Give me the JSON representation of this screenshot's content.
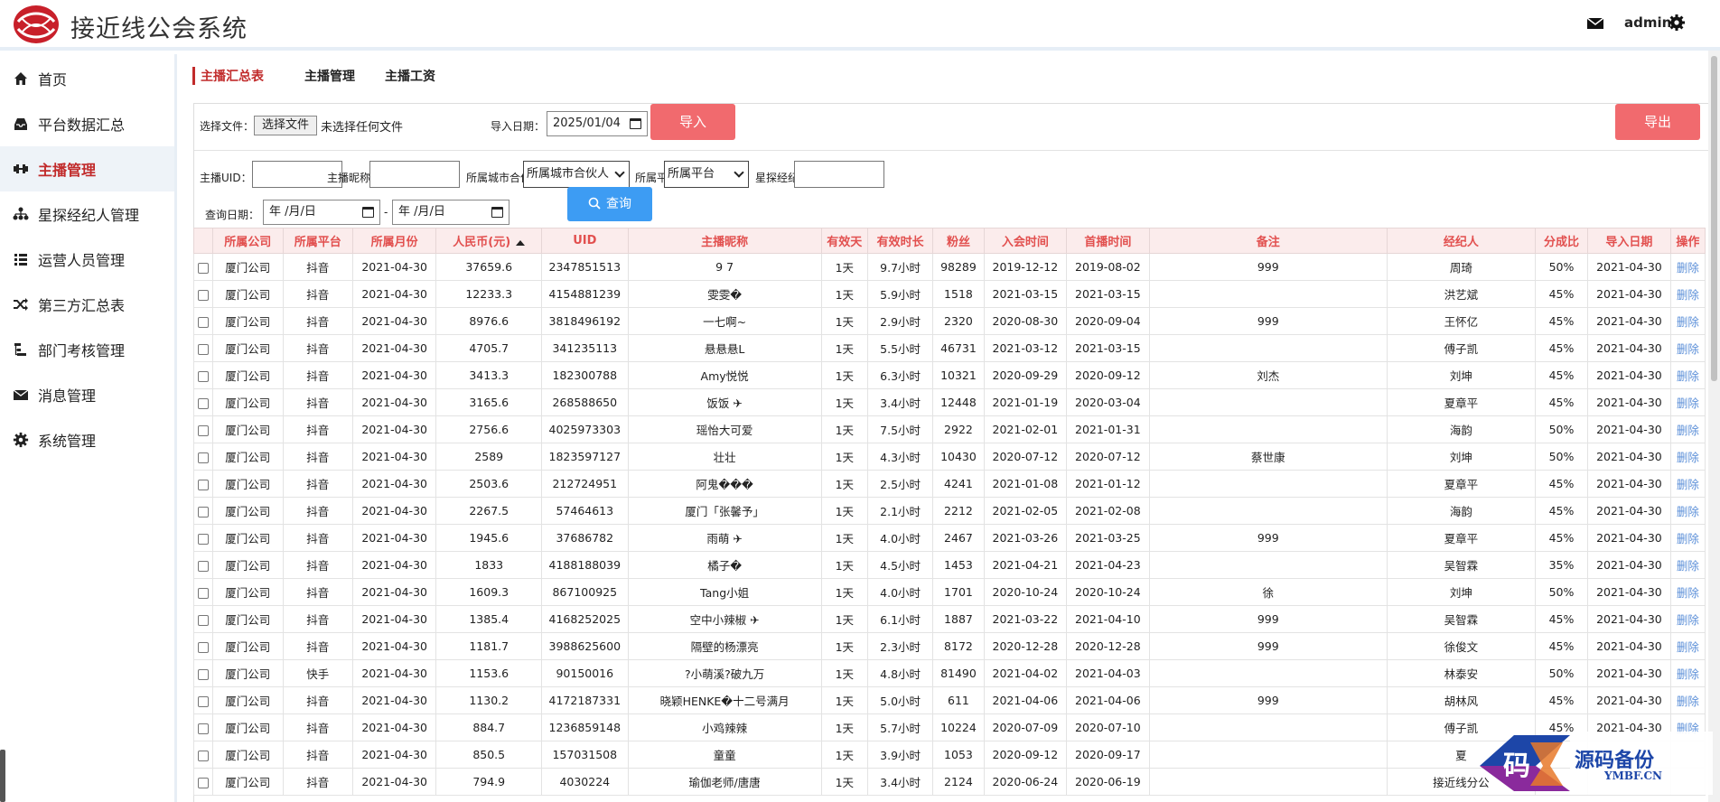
{
  "header": {
    "app_title": "接近线公会系统",
    "user": "admin"
  },
  "sidebar": {
    "items": [
      {
        "label": "首页",
        "icon": "home-icon"
      },
      {
        "label": "平台数据汇总",
        "icon": "inbox-icon"
      },
      {
        "label": "主播管理",
        "icon": "dumbbell-icon"
      },
      {
        "label": "星探经纪人管理",
        "icon": "sitemap-icon"
      },
      {
        "label": "运营人员管理",
        "icon": "list-icon"
      },
      {
        "label": "第三方汇总表",
        "icon": "shuffle-icon"
      },
      {
        "label": "部门考核管理",
        "icon": "tree-icon"
      },
      {
        "label": "消息管理",
        "icon": "envelope-icon"
      },
      {
        "label": "系统管理",
        "icon": "gear-icon"
      }
    ],
    "active_index": 2
  },
  "tabs": {
    "summary": "主播汇总表",
    "management": "主播管理",
    "salary": "主播工资"
  },
  "import_row": {
    "file_label": "选择文件：",
    "file_button": "选择文件",
    "file_status": "未选择任何文件",
    "date_label": "导入日期：",
    "date_value": "2025/01/04",
    "import_button": "导入",
    "export_button": "导出"
  },
  "search_row": {
    "uid_label": "主播UID：",
    "nick_label": "主播昵称：",
    "partner_label": "所属城市合伙人：",
    "partner_value": "所属城市合伙人",
    "platform_label": "所属平台：",
    "platform_value": "所属平台",
    "scout_label": "星探经纪人：",
    "query_date_label": "查询日期：",
    "date_placeholder": "年 /月/日",
    "search_button": "查询"
  },
  "table": {
    "headers": [
      "所属公司",
      "所属平台",
      "所属月份",
      "人民币(元)",
      "UID",
      "主播昵称",
      "有效天",
      "有效时长",
      "粉丝",
      "入会时间",
      "首播时间",
      "备注",
      "经纪人",
      "分成比",
      "导入日期",
      "操作"
    ],
    "rows": [
      [
        "厦门公司",
        "抖音",
        "2021-04-30",
        "37659.6",
        "2347851513",
        "9 7",
        "1天",
        "9.7小时",
        "98289",
        "2019-12-12",
        "2019-08-02",
        "999",
        "周琦",
        "50%",
        "2021-04-30",
        "删除"
      ],
      [
        "厦门公司",
        "抖音",
        "2021-04-30",
        "12233.3",
        "4154881239",
        "雯雯�",
        "1天",
        "5.9小时",
        "1518",
        "2021-03-15",
        "2021-03-15",
        "",
        "洪艺斌",
        "45%",
        "2021-04-30",
        "删除"
      ],
      [
        "厦门公司",
        "抖音",
        "2021-04-30",
        "8976.6",
        "3818496192",
        "一七啊~",
        "1天",
        "2.9小时",
        "2320",
        "2020-08-30",
        "2020-09-04",
        "999",
        "王怀亿",
        "45%",
        "2021-04-30",
        "删除"
      ],
      [
        "厦门公司",
        "抖音",
        "2021-04-30",
        "4705.7",
        "341235113",
        "悬悬悬L",
        "1天",
        "5.5小时",
        "46731",
        "2021-03-12",
        "2021-03-15",
        "",
        "傅子凯",
        "45%",
        "2021-04-30",
        "删除"
      ],
      [
        "厦门公司",
        "抖音",
        "2021-04-30",
        "3413.3",
        "182300788",
        "Amy悦悦",
        "1天",
        "6.3小时",
        "10321",
        "2020-09-29",
        "2020-09-12",
        "刘杰",
        "刘坤",
        "45%",
        "2021-04-30",
        "删除"
      ],
      [
        "厦门公司",
        "抖音",
        "2021-04-30",
        "3165.6",
        "268588650",
        "饭饭 ✈",
        "1天",
        "3.4小时",
        "12448",
        "2021-01-19",
        "2020-03-04",
        "",
        "夏章平",
        "45%",
        "2021-04-30",
        "删除"
      ],
      [
        "厦门公司",
        "抖音",
        "2021-04-30",
        "2756.6",
        "4025973303",
        "瑶怡大可爱",
        "1天",
        "7.5小时",
        "2922",
        "2021-02-01",
        "2021-01-31",
        "",
        "海韵",
        "50%",
        "2021-04-30",
        "删除"
      ],
      [
        "厦门公司",
        "抖音",
        "2021-04-30",
        "2589",
        "1823597127",
        "壮壮",
        "1天",
        "4.3小时",
        "10430",
        "2020-07-12",
        "2020-07-12",
        "蔡世康",
        "刘坤",
        "50%",
        "2021-04-30",
        "删除"
      ],
      [
        "厦门公司",
        "抖音",
        "2021-04-30",
        "2503.6",
        "212724951",
        "阿鬼���",
        "1天",
        "2.5小时",
        "4241",
        "2021-01-08",
        "2021-01-12",
        "",
        "夏章平",
        "45%",
        "2021-04-30",
        "删除"
      ],
      [
        "厦门公司",
        "抖音",
        "2021-04-30",
        "2267.5",
        "57464613",
        "厦门「张馨予」",
        "1天",
        "2.1小时",
        "2212",
        "2021-02-05",
        "2021-02-08",
        "",
        "海韵",
        "45%",
        "2021-04-30",
        "删除"
      ],
      [
        "厦门公司",
        "抖音",
        "2021-04-30",
        "1945.6",
        "37686782",
        "雨萌 ✈",
        "1天",
        "4.0小时",
        "2467",
        "2021-03-26",
        "2021-03-25",
        "999",
        "夏章平",
        "45%",
        "2021-04-30",
        "删除"
      ],
      [
        "厦门公司",
        "抖音",
        "2021-04-30",
        "1833",
        "4188188039",
        "橘子�",
        "1天",
        "4.5小时",
        "1453",
        "2021-04-21",
        "2021-04-23",
        "",
        "吴智霖",
        "35%",
        "2021-04-30",
        "删除"
      ],
      [
        "厦门公司",
        "抖音",
        "2021-04-30",
        "1609.3",
        "867100925",
        "Tang小姐",
        "1天",
        "4.0小时",
        "1701",
        "2020-10-24",
        "2020-10-24",
        "徐",
        "刘坤",
        "50%",
        "2021-04-30",
        "删除"
      ],
      [
        "厦门公司",
        "抖音",
        "2021-04-30",
        "1385.4",
        "4168252025",
        "空中小辣椒 ✈",
        "1天",
        "6.1小时",
        "1887",
        "2021-03-22",
        "2021-04-10",
        "999",
        "吴智霖",
        "45%",
        "2021-04-30",
        "删除"
      ],
      [
        "厦门公司",
        "抖音",
        "2021-04-30",
        "1181.7",
        "3988625600",
        "隔壁的杨漂亮",
        "1天",
        "2.3小时",
        "8172",
        "2020-12-28",
        "2020-12-28",
        "999",
        "徐俊文",
        "45%",
        "2021-04-30",
        "删除"
      ],
      [
        "厦门公司",
        "快手",
        "2021-04-30",
        "1153.6",
        "90150016",
        "?小萌溪?破九万",
        "1天",
        "4.8小时",
        "81490",
        "2021-04-02",
        "2021-04-03",
        "",
        "林泰安",
        "50%",
        "2021-04-30",
        "删除"
      ],
      [
        "厦门公司",
        "抖音",
        "2021-04-30",
        "1130.2",
        "4172187331",
        "晓颖HENKE�十二号满月",
        "1天",
        "5.0小时",
        "611",
        "2021-04-06",
        "2021-04-06",
        "999",
        "胡林风",
        "45%",
        "2021-04-30",
        "删除"
      ],
      [
        "厦门公司",
        "抖音",
        "2021-04-30",
        "884.7",
        "1236859148",
        "小鸡辣辣",
        "1天",
        "5.7小时",
        "10224",
        "2020-07-09",
        "2020-07-10",
        "",
        "傅子凯",
        "45%",
        "2021-04-30",
        "删除"
      ],
      [
        "厦门公司",
        "抖音",
        "2021-04-30",
        "850.5",
        "157031508",
        "童童",
        "1天",
        "3.9小时",
        "1053",
        "2020-09-12",
        "2020-09-17",
        "",
        "夏",
        "",
        "",
        ""
      ],
      [
        "厦门公司",
        "抖音",
        "2021-04-30",
        "794.9",
        "4030224",
        "瑜伽老师/唐唐",
        "1天",
        "3.4小时",
        "2124",
        "2020-06-24",
        "2020-06-19",
        "",
        "接近线分公",
        "",
        "",
        ""
      ]
    ]
  },
  "watermark": {
    "text": "源码备份",
    "sub": "YMBF.CN",
    "glyph": "码"
  },
  "colors": {
    "accent_red": "#c12b2b",
    "button_red": "#f16a6e",
    "button_blue": "#3d9cf3",
    "header_row_bg": "#fbecec"
  }
}
